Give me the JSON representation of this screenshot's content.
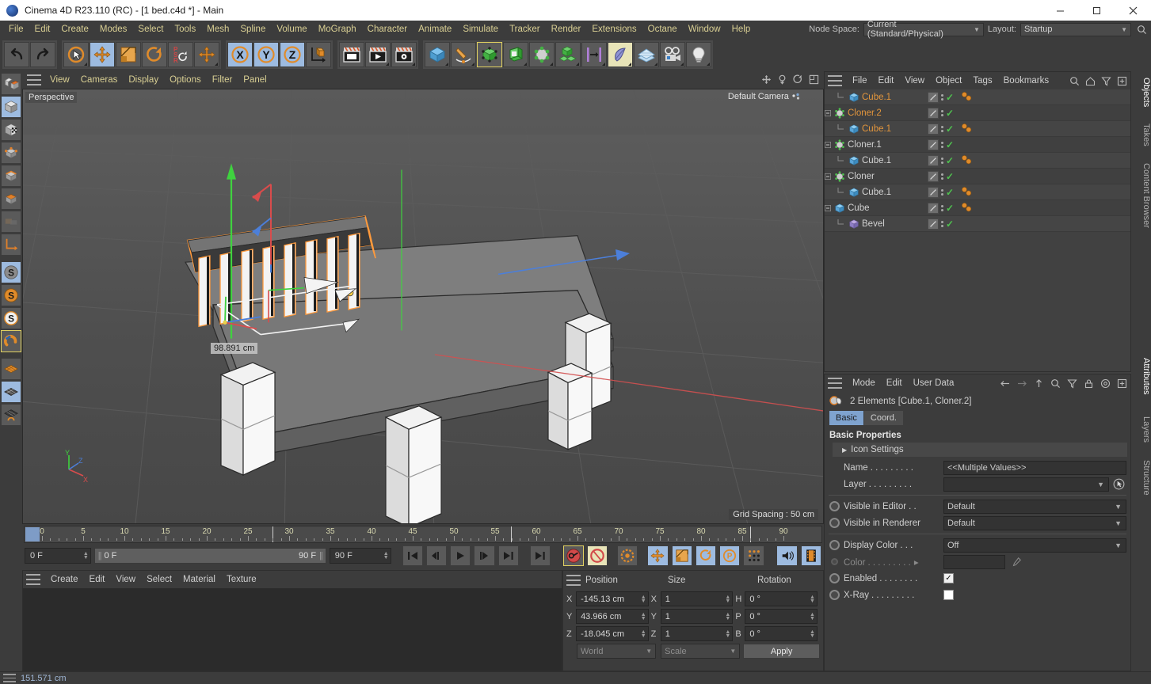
{
  "window": {
    "title": "Cinema 4D R23.110 (RC) - [1 bed.c4d *] - Main",
    "minimize": "─",
    "maximize": "☐",
    "close": "✕"
  },
  "menubar": {
    "items": [
      "File",
      "Edit",
      "Create",
      "Modes",
      "Select",
      "Tools",
      "Mesh",
      "Spline",
      "Volume",
      "MoGraph",
      "Character",
      "Animate",
      "Simulate",
      "Tracker",
      "Render",
      "Extensions",
      "Octane",
      "Window",
      "Help"
    ],
    "node_space_label": "Node Space:",
    "node_space_value": "Current (Standard/Physical)",
    "layout_label": "Layout:",
    "layout_value": "Startup",
    "search_icon": "search-icon"
  },
  "toolbar": {
    "groups": [
      {
        "name": "undo-redo",
        "buttons": [
          {
            "name": "undo-button",
            "icon": "undo-arrow-icon",
            "state": "normal"
          },
          {
            "name": "redo-button",
            "icon": "redo-arrow-icon",
            "state": "normal"
          }
        ]
      },
      {
        "name": "transform-tools",
        "buttons": [
          {
            "name": "live-selection-tool",
            "icon": "cursor-circle-icon",
            "state": "normal"
          },
          {
            "name": "move-tool",
            "icon": "move-cross-icon",
            "state": "selected"
          },
          {
            "name": "scale-tool",
            "icon": "scale-square-icon",
            "state": "normal"
          },
          {
            "name": "rotate-tool",
            "icon": "rotate-circle-icon",
            "state": "normal"
          },
          {
            "name": "psr-tool",
            "icon": "psr-icon",
            "state": "normal"
          },
          {
            "name": "move-tool-alt",
            "icon": "move-cross-icon",
            "state": "normal"
          }
        ]
      },
      {
        "name": "axis-locks",
        "buttons": [
          {
            "name": "lock-x-axis",
            "icon": "x-axis-icon",
            "state": "selected"
          },
          {
            "name": "lock-y-axis",
            "icon": "y-axis-icon",
            "state": "selected"
          },
          {
            "name": "lock-z-axis",
            "icon": "z-axis-icon",
            "state": "selected"
          },
          {
            "name": "world-object-coordinates",
            "icon": "world-coord-icon",
            "state": "normal"
          }
        ]
      },
      {
        "name": "render-tools",
        "buttons": [
          {
            "name": "render-view-button",
            "icon": "render-view-icon",
            "state": "normal"
          },
          {
            "name": "render-to-picture-viewer",
            "icon": "render-picture-icon",
            "state": "normal"
          },
          {
            "name": "render-settings",
            "icon": "render-settings-icon",
            "state": "normal"
          }
        ]
      },
      {
        "name": "object-creation",
        "buttons": [
          {
            "name": "add-cube-object",
            "icon": "cube-blue-icon",
            "state": "normal"
          },
          {
            "name": "add-spline",
            "icon": "pen-spline-icon",
            "state": "normal"
          },
          {
            "name": "add-generator",
            "icon": "generator-green-icon",
            "state": "highlighted"
          },
          {
            "name": "add-deformer",
            "icon": "bend-green-icon",
            "state": "normal"
          },
          {
            "name": "add-scene-object",
            "icon": "scene-gray-icon",
            "state": "normal"
          },
          {
            "name": "add-mograph",
            "icon": "mograph-cubes-icon",
            "state": "normal"
          },
          {
            "name": "add-field",
            "icon": "field-icon",
            "state": "normal"
          },
          {
            "name": "add-hair",
            "icon": "hair-shape-icon",
            "state": "selected-yellow"
          },
          {
            "name": "add-ground",
            "icon": "grid-floor-icon",
            "state": "normal"
          },
          {
            "name": "add-camera",
            "icon": "camera-icon",
            "state": "normal"
          },
          {
            "name": "add-light",
            "icon": "light-bulb-icon",
            "state": "normal"
          }
        ]
      }
    ]
  },
  "leftbar": {
    "buttons": [
      {
        "name": "make-editable-tool",
        "icon": "make-editable-icon",
        "state": "normal"
      },
      {
        "name": "model-mode",
        "icon": "model-cube-icon",
        "state": "selected"
      },
      {
        "name": "texture-mode",
        "icon": "texture-checker-icon",
        "state": "normal"
      },
      {
        "name": "points-mode",
        "icon": "points-cube-icon",
        "state": "normal"
      },
      {
        "name": "edges-mode",
        "icon": "edges-cube-icon",
        "state": "normal"
      },
      {
        "name": "polygons-mode",
        "icon": "polygon-cube-icon",
        "state": "normal"
      },
      {
        "name": "workplane-mode",
        "icon": "workplane-icon",
        "state": "normal"
      },
      {
        "name": "axis-mode",
        "icon": "axis-move-icon",
        "state": "normal"
      },
      {
        "name": "enable-snap",
        "icon": "snap-s-gray-icon",
        "state": "selected"
      },
      {
        "name": "snap-settings-orange",
        "icon": "snap-s-orange-icon",
        "state": "normal"
      },
      {
        "name": "snap-settings-white",
        "icon": "snap-s-white-icon",
        "state": "normal"
      },
      {
        "name": "quantize-snap",
        "icon": "magnet-icon",
        "state": "highlighted"
      },
      {
        "name": "grid-snap",
        "icon": "grid-orange-icon",
        "state": "normal"
      },
      {
        "name": "workplane-snap",
        "icon": "grid-blue-icon",
        "state": "selected"
      },
      {
        "name": "dynamic-workplane",
        "icon": "grid-dynamic-icon",
        "state": "normal"
      }
    ]
  },
  "viewport": {
    "menus": [
      "View",
      "Cameras",
      "Display",
      "Options",
      "Filter",
      "Panel"
    ],
    "nav_icons": [
      "pan-icon",
      "dolly-icon",
      "rotate-icon",
      "maximize-view-icon"
    ],
    "label_perspective": "Perspective",
    "label_camera": "Default Camera",
    "grid_spacing": "Grid Spacing : 50 cm",
    "measurement": "98.891 cm",
    "axis_labels": {
      "x": "X",
      "y": "Y",
      "z": "Z"
    }
  },
  "timeline": {
    "ruler_ticks": [
      0,
      5,
      10,
      15,
      20,
      25,
      30,
      35,
      40,
      45,
      50,
      55,
      60,
      65,
      70,
      75,
      80,
      85,
      90
    ],
    "current_frame": "0 F",
    "range_start": "0 F",
    "range_end": "90 F",
    "max_frame": "90 F",
    "end_frame_right": "0 F",
    "playback_buttons": [
      {
        "name": "go-to-start-button",
        "icon": "skip-start-icon"
      },
      {
        "name": "previous-frame-button",
        "icon": "step-back-icon"
      },
      {
        "name": "play-button",
        "icon": "play-icon"
      },
      {
        "name": "next-frame-button",
        "icon": "step-forward-icon"
      },
      {
        "name": "go-to-end-button",
        "icon": "skip-end-icon"
      },
      {
        "name": "go-to-next-key-button",
        "icon": "next-key-icon"
      }
    ],
    "record_buttons": [
      {
        "name": "record-active-objects-button",
        "icon": "record-key-icon",
        "state": "highlighted"
      },
      {
        "name": "autokeying-button",
        "icon": "autokey-icon",
        "state": "selected-yellow"
      },
      {
        "name": "keyframe-selection-button",
        "icon": "keyframe-gear-icon",
        "state": "normal"
      },
      {
        "name": "position-key-button",
        "icon": "position-cross-icon",
        "state": "selected"
      },
      {
        "name": "scale-key-button",
        "icon": "scale-key-icon",
        "state": "selected"
      },
      {
        "name": "rotation-key-button",
        "icon": "rotation-key-icon",
        "state": "selected"
      },
      {
        "name": "param-key-button",
        "icon": "param-p-icon",
        "state": "selected"
      },
      {
        "name": "point-level-animation-button",
        "icon": "pla-dots-icon",
        "state": "normal"
      }
    ],
    "extra_buttons": [
      {
        "name": "sound-button",
        "icon": "sound-wave-icon",
        "state": "selected"
      },
      {
        "name": "film-strip-button",
        "icon": "film-strip-icon",
        "state": "selected"
      }
    ]
  },
  "material_manager": {
    "menus": [
      "Create",
      "Edit",
      "View",
      "Select",
      "Material",
      "Texture"
    ]
  },
  "coordinates": {
    "columns": [
      "Position",
      "Size",
      "Rotation"
    ],
    "rows": [
      {
        "pos_axis": "X",
        "pos_value": "-145.13 cm",
        "size_axis": "X",
        "size_value": "1",
        "rot_axis": "H",
        "rot_value": "0 °"
      },
      {
        "pos_axis": "Y",
        "pos_value": "43.966 cm",
        "size_axis": "Y",
        "size_value": "1",
        "rot_axis": "P",
        "rot_value": "0 °"
      },
      {
        "pos_axis": "Z",
        "pos_value": "-18.045 cm",
        "size_axis": "Z",
        "size_value": "1",
        "rot_axis": "B",
        "rot_value": "0 °"
      }
    ],
    "system_select": "World",
    "mode_select": "Scale",
    "apply_button": "Apply"
  },
  "object_manager": {
    "menus": [
      "File",
      "Edit",
      "View",
      "Object",
      "Tags",
      "Bookmarks"
    ],
    "header_icons": [
      "search-icon",
      "home-icon",
      "filter-icon",
      "new-window-icon"
    ],
    "items": [
      {
        "name": "Cube.1",
        "indent": 1,
        "icon": "cube-blue-icon",
        "selected": true,
        "expander": "none",
        "has_tags": true,
        "has_material": true
      },
      {
        "name": "Cloner.2",
        "indent": 0,
        "icon": "cloner-green-icon",
        "selected": true,
        "expander": "minus",
        "has_tags": true,
        "has_material": false
      },
      {
        "name": "Cube.1",
        "indent": 1,
        "icon": "cube-blue-icon",
        "selected": true,
        "expander": "none",
        "has_tags": true,
        "has_material": true
      },
      {
        "name": "Cloner.1",
        "indent": 0,
        "icon": "cloner-green-icon",
        "selected": false,
        "expander": "minus",
        "has_tags": true,
        "has_material": false
      },
      {
        "name": "Cube.1",
        "indent": 1,
        "icon": "cube-blue-icon",
        "selected": false,
        "expander": "none",
        "has_tags": true,
        "has_material": true
      },
      {
        "name": "Cloner",
        "indent": 0,
        "icon": "cloner-green-icon",
        "selected": false,
        "expander": "minus",
        "has_tags": true,
        "has_material": false
      },
      {
        "name": "Cube.1",
        "indent": 1,
        "icon": "cube-blue-icon",
        "selected": false,
        "expander": "none",
        "has_tags": true,
        "has_material": true
      },
      {
        "name": "Cube",
        "indent": 0,
        "icon": "cube-blue-icon",
        "selected": false,
        "expander": "minus",
        "has_tags": true,
        "has_material": true
      },
      {
        "name": "Bevel",
        "indent": 1,
        "icon": "bevel-purple-icon",
        "selected": false,
        "expander": "none",
        "has_tags": true,
        "has_material": false
      }
    ]
  },
  "attributes": {
    "menus": [
      "Mode",
      "Edit",
      "User Data"
    ],
    "header_icons": [
      "back-arrow-icon",
      "forward-arrow-icon",
      "up-arrow-icon",
      "search-icon",
      "filter-icon",
      "lock-icon",
      "target-icon",
      "new-window-icon"
    ],
    "selection_label": "2 Elements [Cube.1, Cloner.2]",
    "tabs": [
      {
        "label": "Basic",
        "active": true
      },
      {
        "label": "Coord.",
        "active": false
      }
    ],
    "section_title": "Basic Properties",
    "icon_settings_group": "Icon Settings",
    "fields": [
      {
        "label": "Name",
        "dots": ". . . . . . . . .",
        "type": "text",
        "value": "<<Multiple Values>>",
        "name": "name-field"
      },
      {
        "label": "Layer",
        "dots": ". . . . . . . . .",
        "type": "layer",
        "value": "",
        "name": "layer-field"
      },
      {
        "label": "Visible in Editor",
        "dots": ". .",
        "type": "select",
        "value": "Default",
        "name": "visible-in-editor-select"
      },
      {
        "label": "Visible in Renderer",
        "dots": "",
        "type": "select",
        "value": "Default",
        "name": "visible-in-renderer-select"
      },
      {
        "label": "Display Color",
        "dots": ". . .",
        "type": "select",
        "value": "Off",
        "name": "display-color-select"
      },
      {
        "label": "Color",
        "dots": ". . . . . . . . .",
        "type": "color",
        "value": "",
        "name": "color-field",
        "disabled": true
      },
      {
        "label": "Enabled",
        "dots": ". . . . . . . .",
        "type": "checkbox",
        "value": true,
        "name": "enabled-checkbox"
      },
      {
        "label": "X-Ray",
        "dots": ". . . . . . . . .",
        "type": "checkbox",
        "value": false,
        "name": "xray-checkbox"
      }
    ]
  },
  "right_tabs": {
    "top": [
      {
        "label": "Objects",
        "active": true
      },
      {
        "label": "Takes",
        "active": false
      },
      {
        "label": "Content Browser",
        "active": false
      }
    ],
    "bottom": [
      {
        "label": "Attributes",
        "active": true
      },
      {
        "label": "Layers",
        "active": false
      },
      {
        "label": "Structure",
        "active": false
      }
    ]
  },
  "statusbar": {
    "text": "151.571 cm"
  },
  "colors": {
    "accent_orange": "#e2953c",
    "selection_blue": "#9dbbe0",
    "menu_yellow": "#d9cf93",
    "panel_bg": "#3c3c3c",
    "viewport_bg": "#545454"
  }
}
